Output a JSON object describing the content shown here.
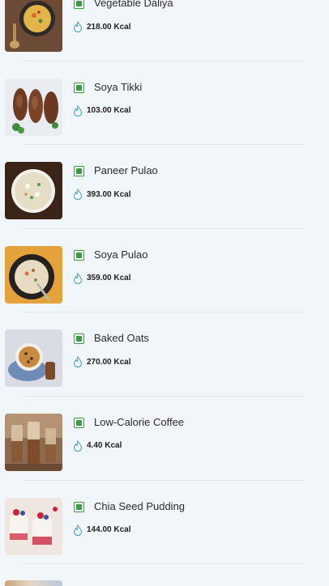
{
  "units": "Kcal",
  "accent_color": "#3c9a3f",
  "flame_color": "#4aa8c9",
  "items": [
    {
      "name": "Vegetable Daliya",
      "kcal": "218.00 Kcal",
      "veg": true,
      "image": "vegetable-daliya-photo"
    },
    {
      "name": "Soya Tikki",
      "kcal": "103.00 Kcal",
      "veg": true,
      "image": "soya-tikki-photo"
    },
    {
      "name": "Paneer Pulao",
      "kcal": "393.00 Kcal",
      "veg": true,
      "image": "paneer-pulao-photo"
    },
    {
      "name": "Soya Pulao",
      "kcal": "359.00 Kcal",
      "veg": true,
      "image": "soya-pulao-photo"
    },
    {
      "name": "Baked Oats",
      "kcal": "270.00 Kcal",
      "veg": true,
      "image": "baked-oats-photo"
    },
    {
      "name": "Low-Calorie Coffee",
      "kcal": "4.40 Kcal",
      "veg": true,
      "image": "coffee-photo"
    },
    {
      "name": "Chia Seed Pudding",
      "kcal": "144.00 Kcal",
      "veg": true,
      "image": "chia-pudding-photo"
    }
  ]
}
